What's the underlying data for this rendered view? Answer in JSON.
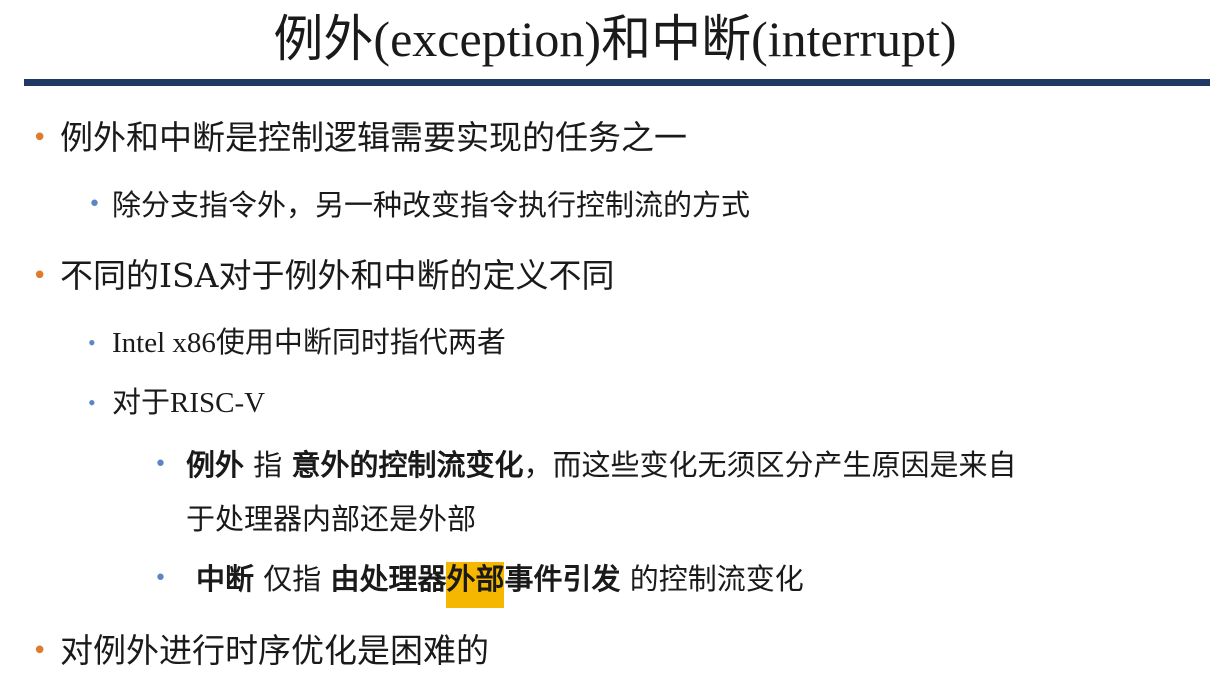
{
  "slide": {
    "title": "例外(exception)和中断(interrupt)",
    "bullets": {
      "b1": "例外和中断是控制逻辑需要实现的任务之一",
      "b1_1": "除分支指令外，另一种改变指令执行控制流的方式",
      "b2": "不同的ISA对于例外和中断的定义不同",
      "b2_1": "Intel x86使用中断同时指代两者",
      "b2_2": "对于RISC-V",
      "exc": {
        "term": "例外",
        "mid": " 指 ",
        "def": "意外的控制流变化",
        "rest1": "，而这些变化无须区分产生原因是来自",
        "rest2": "于处理器内部还是外部"
      },
      "intr": {
        "term": "中断",
        "mid": " 仅指 ",
        "def_a": "由处理器",
        "def_hl": "外部",
        "def_b": "事件引发",
        "rest": " 的控制流变化"
      },
      "b3": "对例外进行时序优化是困难的"
    },
    "bullet_glyph": "•",
    "colors": {
      "rule": "#1f3864",
      "bullet_l1": "#e07a2c",
      "bullet_l2": "#5b86c5",
      "highlight": "#f5b700"
    }
  }
}
